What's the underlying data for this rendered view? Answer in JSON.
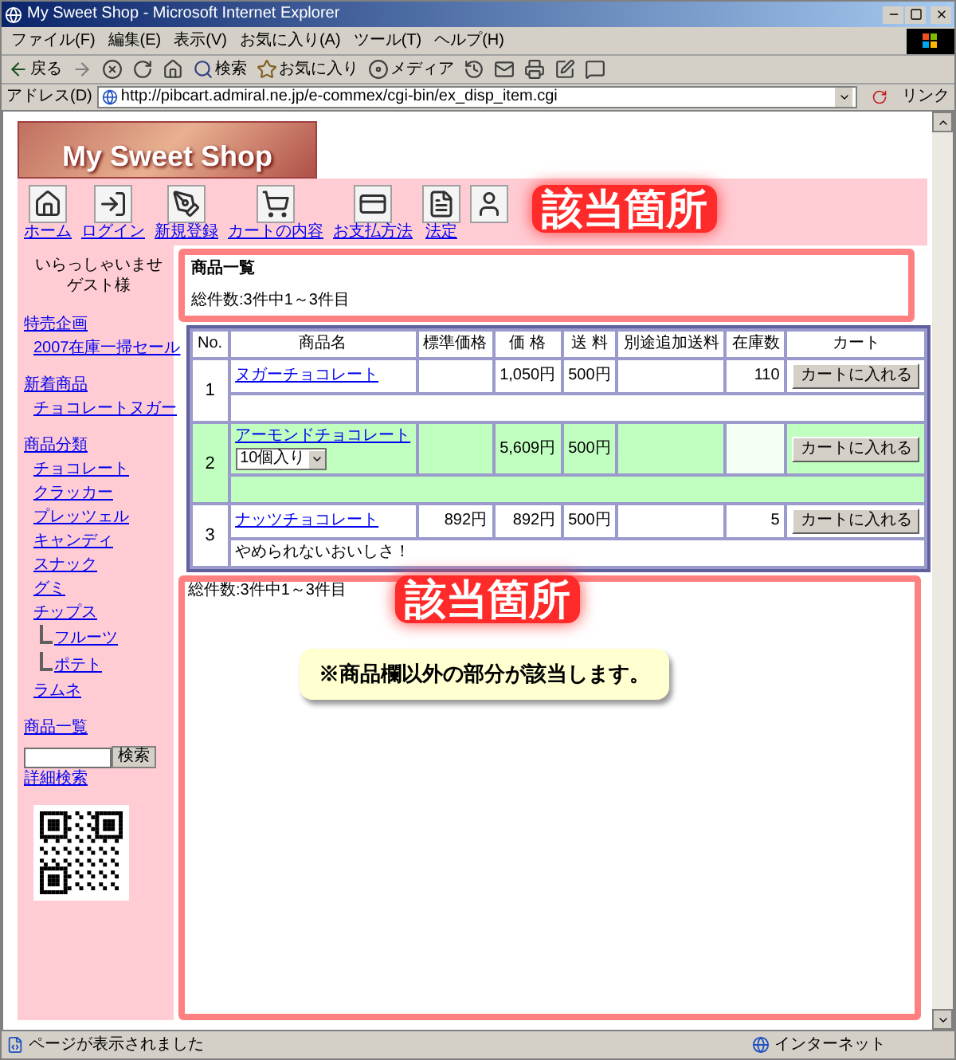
{
  "window": {
    "title": "My Sweet Shop - Microsoft Internet Explorer"
  },
  "menu": [
    "ファイル(F)",
    "編集(E)",
    "表示(V)",
    "お気に入り(A)",
    "ツール(T)",
    "ヘルプ(H)"
  ],
  "toolbar": [
    {
      "kind": "back",
      "label": "戻る"
    },
    {
      "kind": "forward"
    },
    {
      "kind": "stop"
    },
    {
      "kind": "refresh"
    },
    {
      "kind": "home"
    },
    {
      "kind": "search",
      "label": "検索"
    },
    {
      "kind": "favorites",
      "label": "お気に入り"
    },
    {
      "kind": "media",
      "label": "メディア"
    },
    {
      "kind": "history"
    },
    {
      "kind": "mail"
    },
    {
      "kind": "print"
    },
    {
      "kind": "edit"
    },
    {
      "kind": "discuss"
    }
  ],
  "address": {
    "label": "アドレス(D)",
    "url": "http://pibcart.admiral.ne.jp/e-commex/cgi-bin/ex_disp_item.cgi",
    "links": "リンク"
  },
  "shop": {
    "logo": "My Sweet Shop",
    "nav": [
      {
        "kind": "home",
        "label": "ホーム"
      },
      {
        "kind": "login",
        "label": "ログイン"
      },
      {
        "kind": "signup",
        "label": "新規登録"
      },
      {
        "kind": "cart",
        "label": "カートの内容"
      },
      {
        "kind": "payment",
        "label": "お支払方法"
      },
      {
        "kind": "legal",
        "label": "法定"
      },
      {
        "kind": "person"
      }
    ],
    "greeting": [
      "いらっしゃいませ",
      "ゲスト様"
    ],
    "sidebar": [
      {
        "label": "特売企画",
        "children": [
          {
            "label": "2007在庫一掃セール"
          }
        ]
      },
      {
        "label": "新着商品",
        "children": [
          {
            "label": "チョコレートヌガー"
          }
        ]
      },
      {
        "label": "商品分類",
        "children": [
          {
            "label": "チョコレート"
          },
          {
            "label": "クラッカー"
          },
          {
            "label": "プレッツェル"
          },
          {
            "label": "キャンディ"
          },
          {
            "label": "スナック"
          },
          {
            "label": "グミ"
          },
          {
            "label": "チップス",
            "children": [
              {
                "label": "フルーツ"
              },
              {
                "label": "ポテト"
              }
            ]
          },
          {
            "label": "ラムネ"
          }
        ]
      },
      {
        "label": "商品一覧"
      }
    ],
    "search_button": "検索",
    "advanced_search": "詳細検索"
  },
  "content": {
    "heading": "商品一覧",
    "count_top": "総件数:3件中1～3件目",
    "table": {
      "columns": [
        "No.",
        "商品名",
        "標準価格",
        "価 格",
        "送 料",
        "別途追加送料",
        "在庫数",
        "カート"
      ],
      "rows": [
        {
          "no": "1",
          "name": "ヌガーチョコレート",
          "price": "1,050円",
          "shipping": "500円",
          "stock": "110",
          "button": "カートに入れる",
          "highlighted": false
        },
        {
          "no": "2",
          "name": "アーモンドチョコレート",
          "option": "10個入り",
          "price": "5,609円",
          "shipping": "500円",
          "button": "カートに入れる",
          "highlighted": true
        },
        {
          "no": "3",
          "name": "ナッツチョコレート",
          "list_price": "892円",
          "price": "892円",
          "shipping": "500円",
          "stock": "5",
          "button": "カートに入れる",
          "description": "やめられないおいしさ！",
          "highlighted": false
        }
      ]
    },
    "count_bottom": "総件数:3件中1～3件目"
  },
  "annotations": {
    "labels": [
      "該当箇所",
      "該当箇所"
    ],
    "note": "※商品欄以外の部分が該当します。"
  },
  "status_bar": {
    "text": "ページが表示されました",
    "zone": "インターネット"
  }
}
